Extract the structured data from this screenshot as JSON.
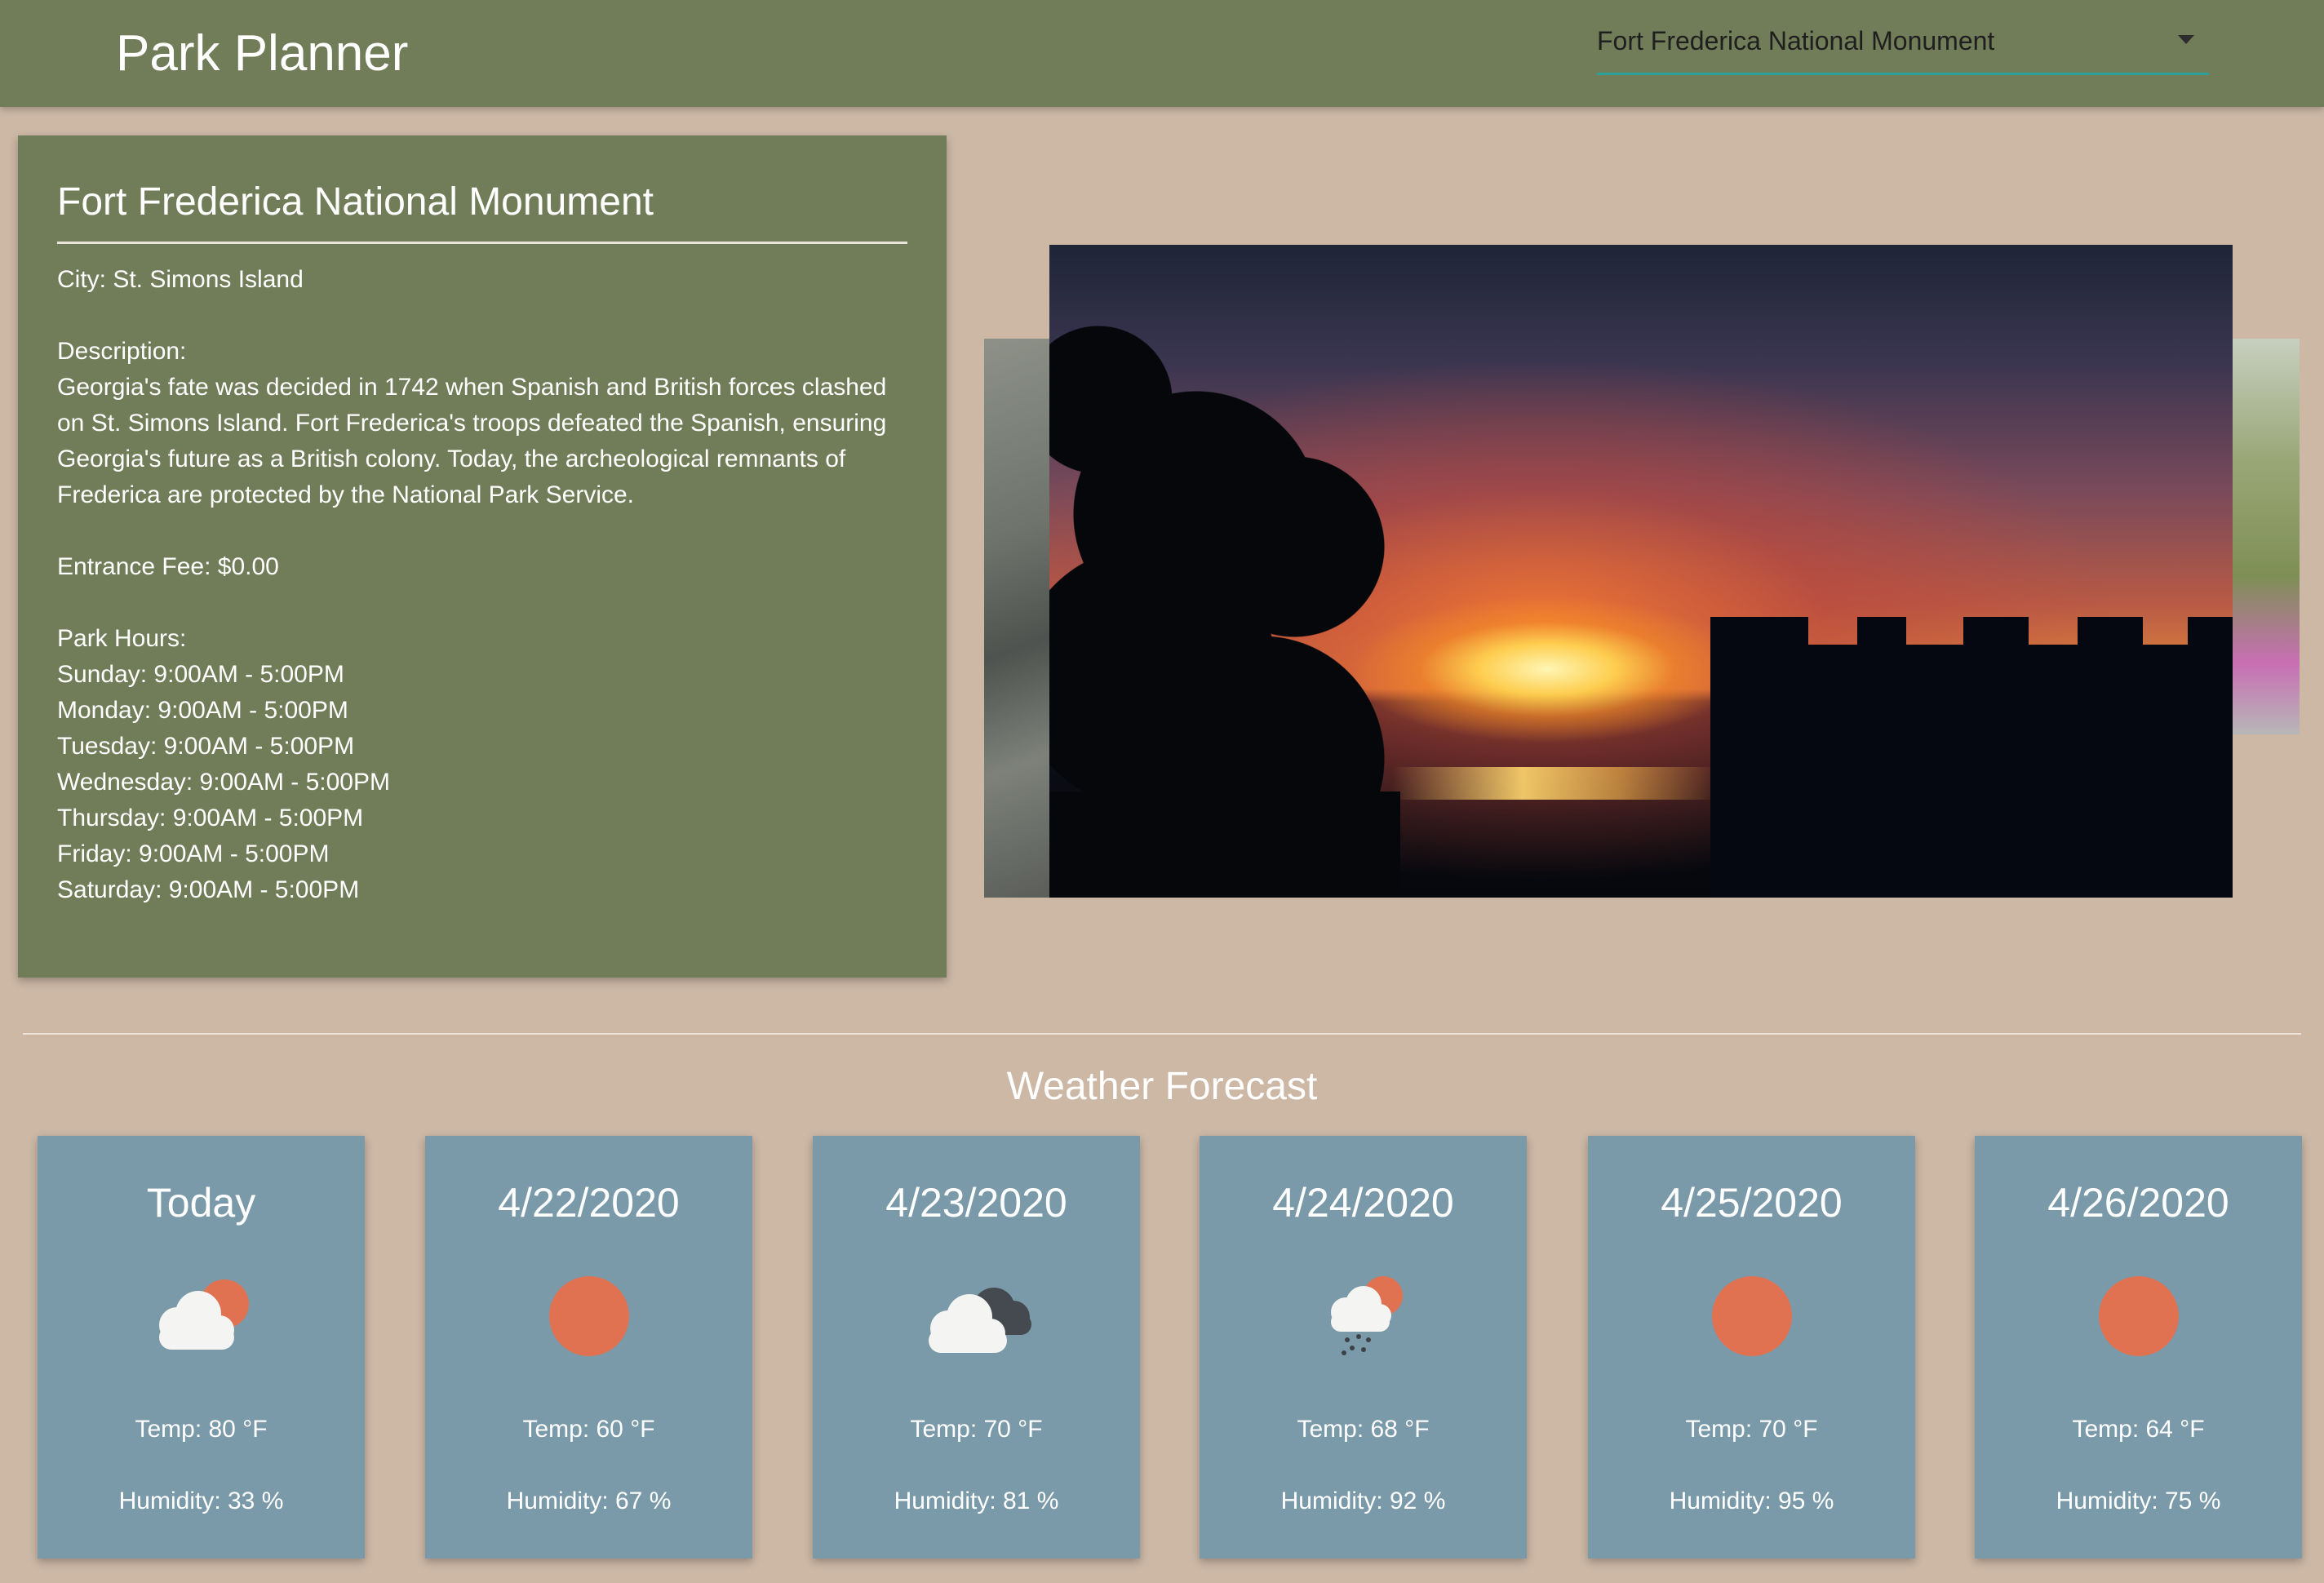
{
  "header": {
    "app_title": "Park Planner",
    "park_select": {
      "selected": "Fort Frederica National Monument",
      "icon": "caret-down-icon"
    }
  },
  "park": {
    "name": "Fort Frederica National Monument",
    "city": "City: St. Simons Island",
    "description_label": "Description:",
    "description_lines": [
      "Georgia's fate was decided in 1742 when Spanish and British forces clashed",
      "on St. Simons Island. Fort Frederica's troops defeated the Spanish, ensuring",
      "Georgia's future as a British colony. Today, the archeological remnants of",
      "Frederica are protected by the National Park Service."
    ],
    "entrance_fee": "Entrance Fee: $0.00",
    "hours_label": "Park Hours:",
    "hours": [
      "Sunday: 9:00AM - 5:00PM",
      "Monday: 9:00AM - 5:00PM",
      "Tuesday: 9:00AM - 5:00PM",
      "Wednesday: 9:00AM - 5:00PM",
      "Thursday: 9:00AM - 5:00PM",
      "Friday: 9:00AM - 5:00PM",
      "Saturday: 9:00AM - 5:00PM"
    ]
  },
  "carousel": {
    "slides": [
      "sunset-over-fort-photo",
      "stone-ruins-photo",
      "trees-and-flowers-photo"
    ]
  },
  "weather": {
    "title": "Weather Forecast",
    "days": [
      {
        "date": "Today",
        "icon": "partly-sunny-cloud-icon",
        "temp": "Temp: 80 °F",
        "humidity": "Humidity: 33 %"
      },
      {
        "date": "4/22/2020",
        "icon": "sun-icon",
        "temp": "Temp: 60 °F",
        "humidity": "Humidity: 67 %"
      },
      {
        "date": "4/23/2020",
        "icon": "dark-clouds-icon",
        "temp": "Temp: 70 °F",
        "humidity": "Humidity: 81 %"
      },
      {
        "date": "4/24/2020",
        "icon": "sun-rain-cloud-icon",
        "temp": "Temp: 68 °F",
        "humidity": "Humidity: 92 %"
      },
      {
        "date": "4/25/2020",
        "icon": "sun-icon",
        "temp": "Temp: 70 °F",
        "humidity": "Humidity: 95 %"
      },
      {
        "date": "4/26/2020",
        "icon": "sun-icon",
        "temp": "Temp: 64 °F",
        "humidity": "Humidity: 75 %"
      }
    ]
  },
  "colors": {
    "page_background": "#cdb8a6",
    "header_and_card": "#717c58",
    "forecast_card": "#7a9aaa",
    "sun": "#e07252",
    "select_underline": "#2aa198"
  }
}
